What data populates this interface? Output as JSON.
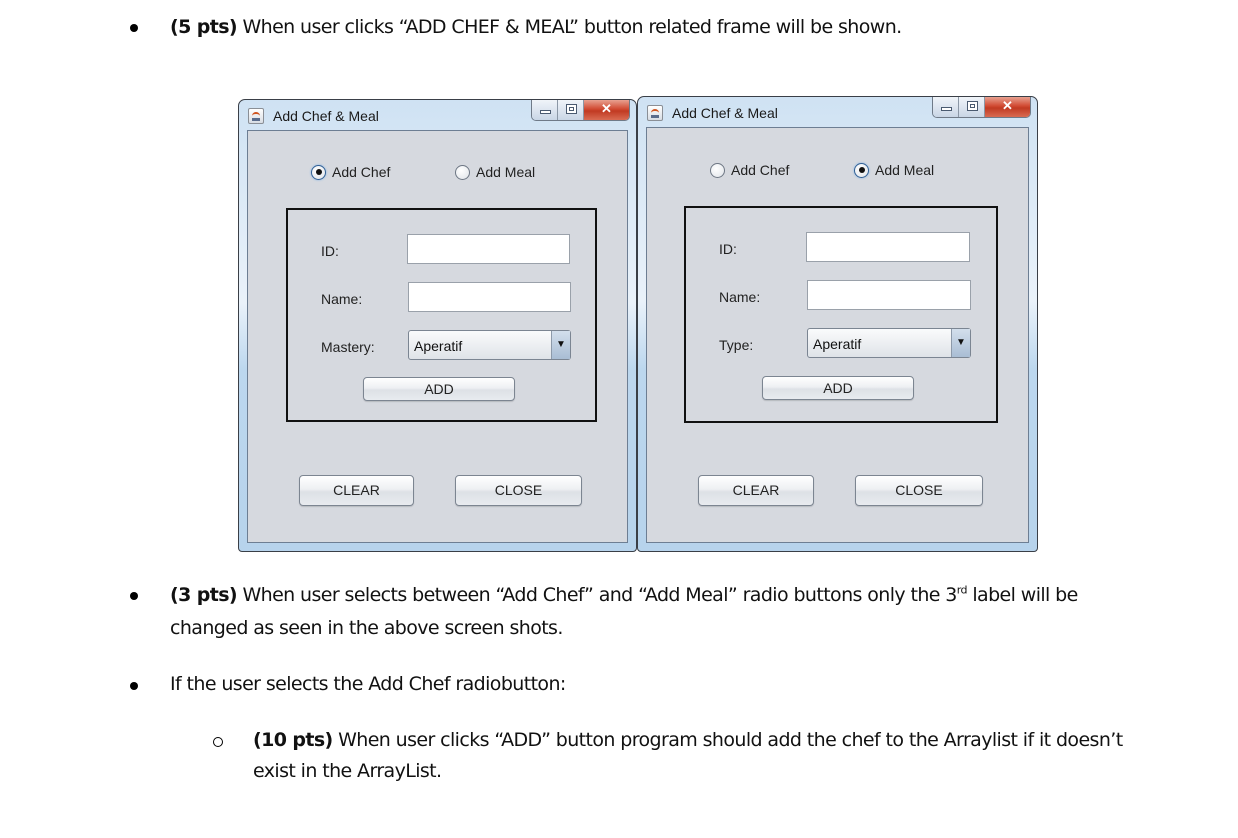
{
  "document": {
    "item1": {
      "points": "(5 pts)",
      "text": " When user clicks “ADD CHEF & MEAL” button related frame will be shown."
    },
    "item2": {
      "points": "(3 pts)",
      "text_before": " When user selects between “Add Chef” and “Add Meal” radio buttons only the 3",
      "superscript": "rd",
      "text_after": " label will be",
      "line2": "changed as seen in the above screen shots."
    },
    "item3": {
      "text": "If the user selects the Add Chef radiobutton:"
    },
    "subitem1": {
      "points": "(10 pts)",
      "text": " When user clicks “ADD” button program should add the chef to the Arraylist if it doesn’t",
      "line2": "exist in the ArrayList."
    }
  },
  "windows": [
    {
      "title": "Add Chef & Meal",
      "controls": {
        "minimize": "minimize",
        "maximize": "maximize",
        "close": "✕"
      },
      "radios": [
        {
          "label": "Add Chef",
          "selected": true
        },
        {
          "label": "Add Meal",
          "selected": false
        }
      ],
      "fields": {
        "id_label": "ID:",
        "id_value": "",
        "name_label": "Name:",
        "name_value": "",
        "third_label": "Mastery:",
        "combo_value": "Aperatif"
      },
      "buttons": {
        "add": "ADD",
        "clear": "CLEAR",
        "close": "CLOSE"
      }
    },
    {
      "title": "Add Chef & Meal",
      "controls": {
        "minimize": "minimize",
        "maximize": "maximize",
        "close": "✕"
      },
      "radios": [
        {
          "label": "Add Chef",
          "selected": false
        },
        {
          "label": "Add Meal",
          "selected": true
        }
      ],
      "fields": {
        "id_label": "ID:",
        "id_value": "",
        "name_label": "Name:",
        "name_value": "",
        "third_label": "Type:",
        "combo_value": "Aperatif"
      },
      "buttons": {
        "add": "ADD",
        "clear": "CLEAR",
        "close": "CLOSE"
      }
    }
  ]
}
